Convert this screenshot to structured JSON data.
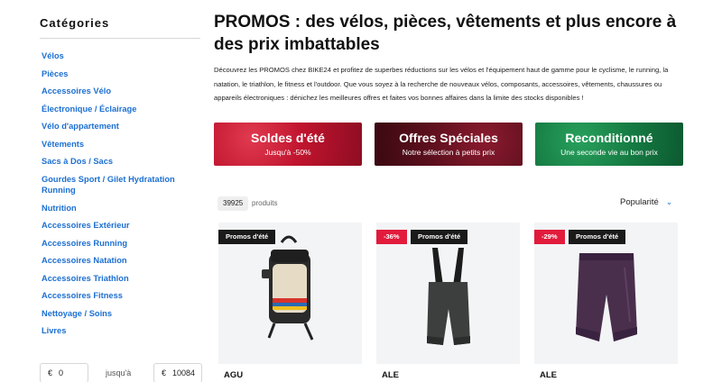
{
  "sidebar": {
    "title": "Catégories",
    "categories": [
      "Vélos",
      "Pièces",
      "Accessoires Vélo",
      "Électronique / Éclairage",
      "Vélo d'appartement",
      "Vêtements",
      "Sacs à Dos / Sacs",
      "Gourdes Sport / Gilet Hydratation Running",
      "Nutrition",
      "Accessoires Extérieur",
      "Accessoires Running",
      "Accessoires Natation",
      "Accessoires Triathlon",
      "Accessoires Fitness",
      "Nettoyage / Soins",
      "Livres"
    ],
    "price": {
      "currency": "€",
      "min": "0",
      "separator": "jusqu'à",
      "max": "10084"
    }
  },
  "main": {
    "title": "PROMOS : des vélos, pièces, vêtements et plus encore à des prix imbattables",
    "intro": "Découvrez les PROMOS chez BIKE24 et profitez de superbes réductions sur les vélos et l'équipement haut de gamme pour le cyclisme, le running, la natation, le triathlon, le fitness et l'outdoor. Que vous soyez à la recherche de nouveaux vélos, composants, accessoires, vêtements, chaussures ou appareils électroniques : dénichez les meilleures offres et faites vos bonnes affaires dans la limite des stocks disponibles !",
    "banners": [
      {
        "title": "Soldes d'été",
        "subtitle": "Jusqu'à -50%"
      },
      {
        "title": "Offres Spéciales",
        "subtitle": "Notre sélection à petits prix"
      },
      {
        "title": "Reconditionné",
        "subtitle": "Une seconde vie au bon prix"
      }
    ],
    "product_count": "39925",
    "product_count_label": "produits",
    "sort_label": "Popularité",
    "products": [
      {
        "brand": "AGU",
        "promo_tag": "Promos d'été",
        "discount": ""
      },
      {
        "brand": "ALE",
        "promo_tag": "Promos d'été",
        "discount": "-36%"
      },
      {
        "brand": "ALE",
        "promo_tag": "Promos d'été",
        "discount": "-29%"
      }
    ]
  },
  "colors": {
    "link_blue": "#1c6fd1",
    "discount_red": "#e21b3c",
    "tag_black": "#1a1a1a",
    "banner_red": "#c0142e",
    "banner_bordeaux": "#5c0f1d",
    "banner_green": "#157a42"
  }
}
